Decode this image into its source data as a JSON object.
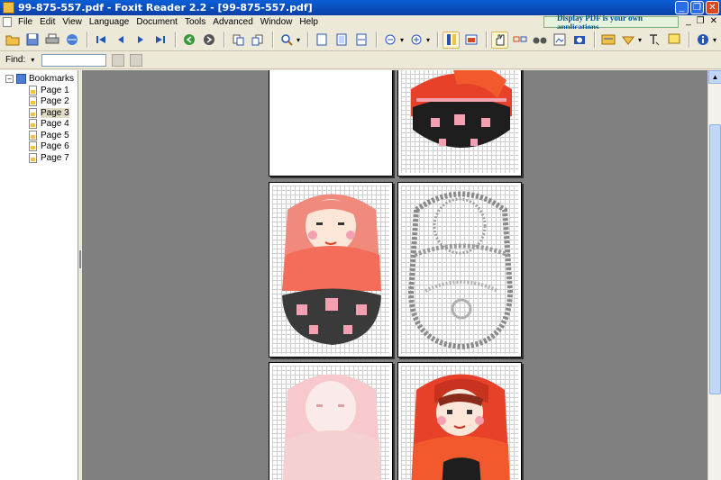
{
  "window": {
    "title": "99-875-557.pdf - Foxit Reader 2.2 - [99-875-557.pdf]",
    "buttons": [
      "_",
      "❐",
      "✕"
    ]
  },
  "menu": {
    "items": [
      "File",
      "Edit",
      "View",
      "Language",
      "Document",
      "Tools",
      "Advanced",
      "Window",
      "Help"
    ],
    "ad_text": "Display PDF is your own applications",
    "mdi_buttons": [
      "_",
      "❐",
      "✕"
    ]
  },
  "toolbar": {
    "icons": [
      "open-icon",
      "save-icon",
      "print-icon",
      "email-icon",
      "first-page-icon",
      "prev-page-icon",
      "next-page-icon",
      "last-page-icon",
      "go-back-icon",
      "go-forward-icon",
      "rotate-left-icon",
      "rotate-right-icon",
      "zoom-icon",
      "actual-size-icon",
      "fit-page-icon",
      "fit-width-icon",
      "zoom-out-icon",
      "zoom-in-icon",
      "single-page-icon",
      "continuous-icon",
      "hand-tool-icon",
      "select-tool-icon",
      "find-icon",
      "snapshot-icon",
      "camera-icon",
      "comment-icon",
      "highlight-icon",
      "typewriter-icon",
      "note-icon",
      "info-icon"
    ]
  },
  "find": {
    "label": "Find:",
    "value": "",
    "placeholder": ""
  },
  "bookmarks": {
    "root": "Bookmarks",
    "items": [
      "Page 1",
      "Page 2",
      "Page 3",
      "Page 4",
      "Page 5",
      "Page 6",
      "Page 7"
    ],
    "selected_index": 2
  },
  "colors": {
    "titlebar": "#0a4fc4",
    "doll_red": "#e8412a",
    "doll_pink": "#f08a7c",
    "doll_black": "#1e1e1e",
    "doc_bg": "#808080"
  }
}
